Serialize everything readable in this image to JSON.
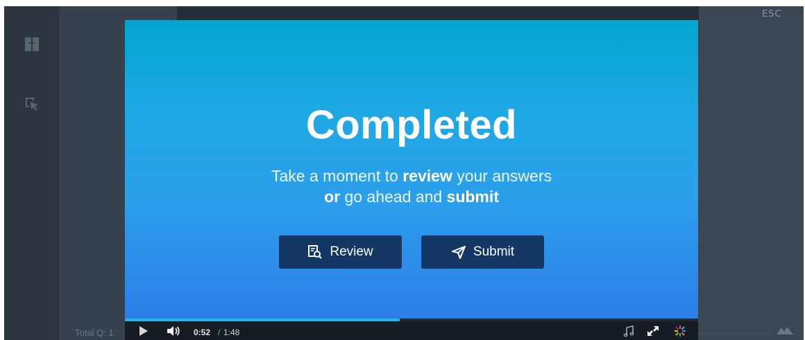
{
  "window": {
    "esc_label": "ESC",
    "total_q": "Total Q: 1"
  },
  "slide": {
    "title": "Completed",
    "subtitle": {
      "line1_a": "Take a moment to ",
      "line1_b": "review",
      "line1_c": " your answers",
      "line2_a": "or",
      "line2_b": " go ahead and ",
      "line2_c": "submit"
    },
    "review_button": "Review",
    "submit_button": "Submit"
  },
  "player": {
    "current_time": "0:52",
    "time_separator": "/",
    "total_time": "1:48",
    "progress_fraction": 0.48
  },
  "colors": {
    "button_bg": "#143766",
    "slide_top": "#04a4cf",
    "slide_bottom": "#2d7ee8",
    "progress": "#25b6e4"
  },
  "icons": {
    "sidebar": [
      "book-icon",
      "pointer-icon"
    ],
    "review": "review-search-icon",
    "submit": "paper-plane-icon",
    "player": [
      "play-icon",
      "volume-icon",
      "music-note-icon",
      "expand-icon",
      "brand-logo-icon"
    ],
    "footer": "mountain-icon"
  }
}
